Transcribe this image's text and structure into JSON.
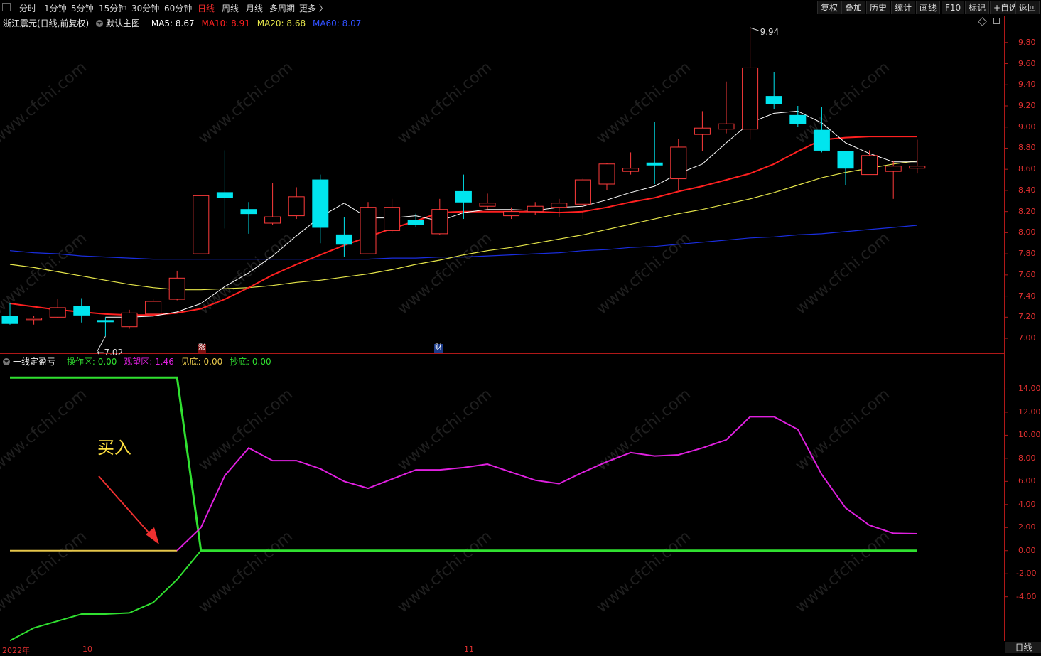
{
  "toolbar": {
    "periods": [
      "分时",
      "1分钟",
      "5分钟",
      "15分钟",
      "30分钟",
      "60分钟",
      "日线",
      "周线",
      "月线",
      "多周期",
      "更多 〉"
    ],
    "active_period": "日线",
    "right_buttons": [
      "复权",
      "叠加",
      "历史",
      "统计",
      "画线",
      "F10",
      "标记",
      "+自选",
      "返回"
    ]
  },
  "main_legend": {
    "stock": "浙江震元(日线,前复权)",
    "template": "默认主图",
    "ma5": "MA5: 8.67",
    "ma10": "MA10: 8.91",
    "ma20": "MA20: 8.68",
    "ma60": "MA60: 8.07"
  },
  "sub_legend": {
    "name": "一线定盈亏",
    "op": "操作区: 0.00",
    "watch": "观望区: 1.46",
    "bottom": "见底: 0.00",
    "buy_bottom": "抄底: 0.00"
  },
  "annotations": {
    "high_label": "9.94",
    "low_label": "7.02",
    "buy_text": "买入",
    "badge_zhang": "涨",
    "badge_cai": "财",
    "watermark": "www.cfchi.com"
  },
  "colors": {
    "up": "#ff3b3b",
    "down": "#00e5ee",
    "ma5": "#ffffff",
    "ma10": "#ff2020",
    "ma20": "#e6e64a",
    "ma60": "#1a2ee0",
    "watch": "#e020e0",
    "op": "#30e030",
    "bottom_line": "#e6c64a"
  },
  "bottom_axis": {
    "year": "2022年",
    "m1": "10",
    "m2": "11",
    "day_tab": "日线"
  },
  "chart_data": [
    {
      "type": "candlestick",
      "title": "浙江震元(日线,前复权)",
      "y_ticks": [
        "9.80",
        "9.60",
        "9.40",
        "9.20",
        "9.00",
        "8.80",
        "8.60",
        "8.40",
        "8.20",
        "8.00",
        "7.80",
        "7.60",
        "7.40",
        "7.20",
        "7.00"
      ],
      "ylim": [
        6.96,
        9.96
      ],
      "candles": [
        {
          "o": 7.21,
          "h": 7.33,
          "l": 7.13,
          "c": 7.14
        },
        {
          "o": 7.18,
          "h": 7.21,
          "l": 7.13,
          "c": 7.19
        },
        {
          "o": 7.2,
          "h": 7.37,
          "l": 7.19,
          "c": 7.29
        },
        {
          "o": 7.3,
          "h": 7.38,
          "l": 7.15,
          "c": 7.22
        },
        {
          "o": 7.17,
          "h": 7.2,
          "l": 7.02,
          "c": 7.16
        },
        {
          "o": 7.11,
          "h": 7.27,
          "l": 7.09,
          "c": 7.24
        },
        {
          "o": 7.23,
          "h": 7.37,
          "l": 7.21,
          "c": 7.35
        },
        {
          "o": 7.37,
          "h": 7.64,
          "l": 7.36,
          "c": 7.57
        },
        {
          "o": 7.8,
          "h": 8.35,
          "l": 7.8,
          "c": 8.35
        },
        {
          "o": 8.38,
          "h": 8.78,
          "l": 8.04,
          "c": 8.33
        },
        {
          "o": 8.22,
          "h": 8.29,
          "l": 7.99,
          "c": 8.18
        },
        {
          "o": 8.09,
          "h": 8.47,
          "l": 8.07,
          "c": 8.15
        },
        {
          "o": 8.16,
          "h": 8.43,
          "l": 8.13,
          "c": 8.34
        },
        {
          "o": 8.5,
          "h": 8.55,
          "l": 7.9,
          "c": 8.05
        },
        {
          "o": 7.98,
          "h": 8.15,
          "l": 7.77,
          "c": 7.89
        },
        {
          "o": 7.8,
          "h": 8.29,
          "l": 7.8,
          "c": 8.24
        },
        {
          "o": 8.02,
          "h": 8.32,
          "l": 8.0,
          "c": 8.24
        },
        {
          "o": 8.12,
          "h": 8.18,
          "l": 8.05,
          "c": 8.08
        },
        {
          "o": 7.99,
          "h": 8.32,
          "l": 7.98,
          "c": 8.22
        },
        {
          "o": 8.39,
          "h": 8.55,
          "l": 8.13,
          "c": 8.29
        },
        {
          "o": 8.25,
          "h": 8.37,
          "l": 8.22,
          "c": 8.28
        },
        {
          "o": 8.16,
          "h": 8.24,
          "l": 8.13,
          "c": 8.2
        },
        {
          "o": 8.2,
          "h": 8.29,
          "l": 8.17,
          "c": 8.25
        },
        {
          "o": 8.24,
          "h": 8.32,
          "l": 8.15,
          "c": 8.28
        },
        {
          "o": 8.27,
          "h": 8.52,
          "l": 8.13,
          "c": 8.5
        },
        {
          "o": 8.46,
          "h": 8.66,
          "l": 8.4,
          "c": 8.65
        },
        {
          "o": 8.58,
          "h": 8.76,
          "l": 8.55,
          "c": 8.61
        },
        {
          "o": 8.66,
          "h": 9.05,
          "l": 8.46,
          "c": 8.64
        },
        {
          "o": 8.51,
          "h": 8.89,
          "l": 8.4,
          "c": 8.81
        },
        {
          "o": 8.93,
          "h": 9.15,
          "l": 8.77,
          "c": 8.99
        },
        {
          "o": 8.98,
          "h": 9.43,
          "l": 8.94,
          "c": 9.03
        },
        {
          "o": 8.98,
          "h": 9.94,
          "l": 8.88,
          "c": 9.56
        },
        {
          "o": 9.29,
          "h": 9.52,
          "l": 9.17,
          "c": 9.22
        },
        {
          "o": 9.11,
          "h": 9.2,
          "l": 9.0,
          "c": 9.03
        },
        {
          "o": 8.97,
          "h": 9.19,
          "l": 8.76,
          "c": 8.78
        },
        {
          "o": 8.77,
          "h": 8.77,
          "l": 8.45,
          "c": 8.61
        },
        {
          "o": 8.55,
          "h": 8.78,
          "l": 8.55,
          "c": 8.73
        },
        {
          "o": 8.58,
          "h": 8.68,
          "l": 8.32,
          "c": 8.63
        },
        {
          "o": 8.61,
          "h": 8.88,
          "l": 8.56,
          "c": 8.63
        }
      ],
      "ma": {
        "MA5": [
          null,
          null,
          null,
          null,
          7.2,
          7.2,
          7.21,
          7.25,
          7.33,
          7.49,
          7.62,
          7.78,
          7.97,
          8.15,
          8.28,
          8.14,
          8.14,
          8.16,
          8.11,
          8.19,
          8.22,
          8.22,
          8.21,
          8.24,
          8.25,
          8.31,
          8.38,
          8.44,
          8.56,
          8.65,
          8.85,
          9.04,
          9.13,
          9.15,
          9.04,
          8.85,
          8.75,
          8.67,
          8.67
        ],
        "MA10": [
          7.33,
          7.3,
          7.27,
          7.25,
          7.23,
          7.22,
          7.22,
          7.24,
          7.28,
          7.37,
          7.48,
          7.6,
          7.7,
          7.79,
          7.88,
          7.96,
          8.04,
          8.11,
          8.19,
          8.2,
          8.2,
          8.2,
          8.2,
          8.19,
          8.2,
          8.24,
          8.29,
          8.33,
          8.39,
          8.44,
          8.5,
          8.56,
          8.65,
          8.77,
          8.88,
          8.9,
          8.91,
          8.91,
          8.91
        ],
        "MA20": [
          7.7,
          7.67,
          7.63,
          7.59,
          7.55,
          7.51,
          7.48,
          7.46,
          7.46,
          7.47,
          7.48,
          7.5,
          7.53,
          7.55,
          7.58,
          7.61,
          7.65,
          7.7,
          7.74,
          7.79,
          7.83,
          7.86,
          7.9,
          7.94,
          7.98,
          8.03,
          8.08,
          8.13,
          8.18,
          8.22,
          8.27,
          8.32,
          8.38,
          8.45,
          8.52,
          8.57,
          8.61,
          8.65,
          8.68
        ],
        "MA60": [
          7.83,
          7.81,
          7.8,
          7.78,
          7.77,
          7.76,
          7.75,
          7.75,
          7.75,
          7.75,
          7.75,
          7.75,
          7.75,
          7.75,
          7.75,
          7.75,
          7.76,
          7.76,
          7.77,
          7.77,
          7.78,
          7.79,
          7.8,
          7.81,
          7.83,
          7.84,
          7.86,
          7.87,
          7.89,
          7.91,
          7.93,
          7.95,
          7.96,
          7.98,
          7.99,
          8.01,
          8.03,
          8.05,
          8.07
        ]
      }
    },
    {
      "type": "line",
      "title": "一线定盈亏",
      "y_ticks": [
        "14.00",
        "12.00",
        "10.00",
        "8.00",
        "6.00",
        "4.00",
        "2.00",
        "0.00",
        "-2.00",
        "-4.00"
      ],
      "ylim": [
        -7.9,
        16.0
      ],
      "series": [
        {
          "name": "观望区",
          "values": [
            0,
            0,
            0,
            0,
            0,
            0,
            0,
            0,
            2.0,
            6.5,
            8.9,
            7.8,
            7.8,
            7.1,
            6.0,
            5.4,
            6.2,
            7.0,
            7.0,
            7.2,
            7.5,
            6.8,
            6.1,
            5.8,
            6.8,
            7.7,
            8.5,
            8.2,
            8.3,
            8.9,
            9.6,
            11.6,
            11.6,
            10.5,
            6.6,
            3.7,
            2.2,
            1.5,
            1.46
          ]
        },
        {
          "name": "操作区",
          "values": [
            15,
            15,
            15,
            15,
            15,
            15,
            15,
            15,
            0,
            0,
            0,
            0,
            0,
            0,
            0,
            0,
            0,
            0,
            0,
            0,
            0,
            0,
            0,
            0,
            0,
            0,
            0,
            0,
            0,
            0,
            0,
            0,
            0,
            0,
            0,
            0,
            0,
            0,
            0
          ]
        },
        {
          "name": "见底",
          "values": [
            -7.8,
            -6.7,
            -6.1,
            -5.5,
            -5.5,
            -5.4,
            -4.5,
            -2.5,
            0,
            0,
            0,
            0,
            0,
            0,
            0,
            0,
            0,
            0,
            0,
            0,
            0,
            0,
            0,
            0,
            0,
            0,
            0,
            0,
            0,
            0,
            0,
            0,
            0,
            0,
            0,
            0,
            0,
            0,
            0
          ]
        }
      ]
    }
  ]
}
